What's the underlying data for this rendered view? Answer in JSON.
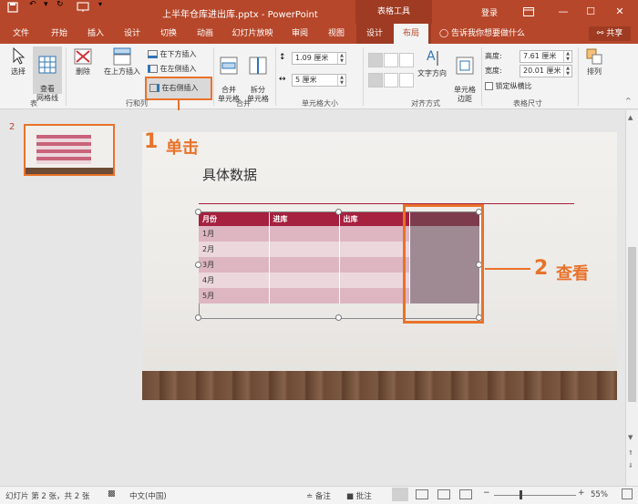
{
  "title_bar": {
    "doc_title": "上半年仓库进出库.pptx - PowerPoint",
    "context_tools": "表格工具",
    "login": "登录",
    "quick_icons": [
      "save-icon",
      "undo-icon",
      "redo-icon",
      "start-from-beginning-icon",
      "customize-qat-icon"
    ],
    "window_icons": [
      "ribbon-display-icon",
      "minimize-icon",
      "maximize-icon",
      "close-icon"
    ]
  },
  "tabs": [
    {
      "label": "文件"
    },
    {
      "label": "开始"
    },
    {
      "label": "插入"
    },
    {
      "label": "设计"
    },
    {
      "label": "切换"
    },
    {
      "label": "动画"
    },
    {
      "label": "幻灯片放映"
    },
    {
      "label": "审阅"
    },
    {
      "label": "视图"
    },
    {
      "label": "设计"
    },
    {
      "label": "布局"
    }
  ],
  "tell_me": "告诉我你想要做什么",
  "share": "共享",
  "ribbon": {
    "table_group": {
      "select": "选择",
      "gridlines": "查看\n网格线",
      "label": "表"
    },
    "rows_cols": {
      "delete": "删除",
      "insert_above": "在上方插入",
      "insert_below": "在下方插入",
      "insert_left": "在左侧插入",
      "insert_right": "在右侧插入",
      "label": "行和列"
    },
    "merge": {
      "merge_cells": "合并\n单元格",
      "split_cells": "拆分\n单元格",
      "label": "合并"
    },
    "cell_size": {
      "height": "1.09 厘米",
      "width": "5 厘米",
      "label": "单元格大小"
    },
    "alignment": {
      "text_direction": "文字方向",
      "cell_margins": "单元格\n边距",
      "label": "对齐方式"
    },
    "table_size": {
      "height_label": "高度:",
      "height": "7.61 厘米",
      "width_label": "宽度:",
      "width": "20.01 厘米",
      "lock": "锁定纵横比",
      "label": "表格尺寸"
    },
    "arrange": {
      "label": "排列"
    }
  },
  "thumbnail": {
    "number": "2"
  },
  "slide": {
    "title": "具体数据",
    "table": {
      "headers": [
        "月份",
        "进库",
        "出库",
        ""
      ],
      "rows": [
        [
          "1月",
          "",
          "",
          ""
        ],
        [
          "2月",
          "",
          "",
          ""
        ],
        [
          "3月",
          "",
          "",
          ""
        ],
        [
          "4月",
          "",
          "",
          ""
        ],
        [
          "5月",
          "",
          "",
          ""
        ]
      ]
    }
  },
  "callouts": {
    "step1_num": "1",
    "step1_text": "单击",
    "step2_num": "2",
    "step2_text": "查看",
    "accent": "#e8722a"
  },
  "status": {
    "slide_info": "幻灯片 第 2 张，共 2 张",
    "language": "中文(中国)",
    "notes": "备注",
    "comments": "批注",
    "zoom": "55%"
  },
  "colors": {
    "brand": "#b7472a",
    "table_header": "#a6203f"
  }
}
